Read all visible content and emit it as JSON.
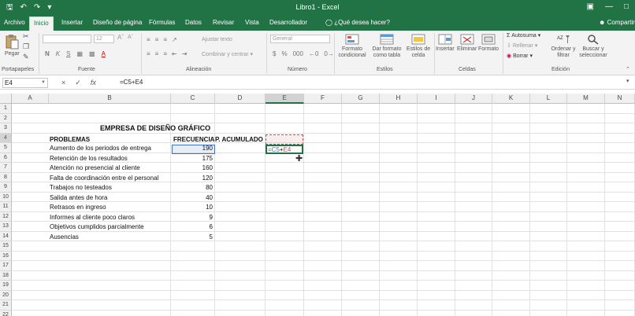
{
  "app": {
    "title": "Libro1  -  Excel",
    "qat": [
      "save",
      "undo",
      "redo",
      "customize"
    ]
  },
  "tabs": [
    "Archivo",
    "Inicio",
    "Insertar",
    "Diseño de página",
    "Fórmulas",
    "Datos",
    "Revisar",
    "Vista",
    "Desarrollador"
  ],
  "tell_me": "¿Qué desea hacer?",
  "share": "Compartir",
  "ribbon": {
    "clipboard": {
      "paste": "Pegar",
      "label": "Portapapeles"
    },
    "font": {
      "name_value": "",
      "size_value": "12",
      "label": "Fuente",
      "styles": [
        "N",
        "K",
        "S"
      ]
    },
    "alignment": {
      "wrap": "Ajustar texto",
      "merge": "Combinar y centrar",
      "label": "Alineación"
    },
    "number": {
      "format_value": "General",
      "label": "Número",
      "symbols": [
        "$",
        "%",
        "000"
      ]
    },
    "styles": {
      "conditional": "Formato condicional",
      "as_table": "Dar formato como tabla",
      "cell_styles": "Estilos de celda",
      "label": "Estilos"
    },
    "cells": {
      "insert": "Insertar",
      "delete": "Eliminar",
      "format": "Formato",
      "label": "Celdas"
    },
    "editing": {
      "autosum": "Autosuma",
      "fill": "Rellenar",
      "clear": "Borrar",
      "sort": "Ordenar y filtrar",
      "find": "Buscar y seleccionar",
      "label": "Edición"
    }
  },
  "formula_bar": {
    "name_box": "E4",
    "formula": "=C5+E4",
    "buttons": [
      "×",
      "✓",
      "fx"
    ]
  },
  "sheet": {
    "columns": [
      "A",
      "B",
      "C",
      "D",
      "E",
      "F",
      "G",
      "H",
      "I",
      "J",
      "K",
      "L",
      "M",
      "N"
    ],
    "rows": [
      "1",
      "2",
      "3",
      "4",
      "5",
      "6",
      "7",
      "8",
      "9",
      "10",
      "11",
      "12",
      "13",
      "14",
      "15",
      "16",
      "17",
      "18",
      "19",
      "20",
      "21",
      "22"
    ],
    "title": "EMPRESA DE DISEÑO GRÁFICO",
    "headers": {
      "problemas": "PROBLEMAS",
      "frecuencia": "FRECUENCIA",
      "acumulado": "P. ACUMULADO"
    },
    "records": [
      {
        "problema": "Aumento de los periodos de entrega",
        "frecuencia": "190"
      },
      {
        "problema": "Retención de los resultados",
        "frecuencia": "175"
      },
      {
        "problema": "Atención no presencial al cliente",
        "frecuencia": "160"
      },
      {
        "problema": "Falta de coordinación entre el personal",
        "frecuencia": "120"
      },
      {
        "problema": "Trabajos no testeados",
        "frecuencia": "80"
      },
      {
        "problema": "Salida antes de hora",
        "frecuencia": "40"
      },
      {
        "problema": "Retrasos en ingreso",
        "frecuencia": "10"
      },
      {
        "problema": "Informes al cliente poco claros",
        "frecuencia": "9"
      },
      {
        "problema": "Objetivos cumplidos parcialmente",
        "frecuencia": "6"
      },
      {
        "problema": "Ausencias",
        "frecuencia": "5"
      }
    ],
    "editing_cell_text": "=C5+E4",
    "colors": {
      "accent": "#217346",
      "ref_blue": "#4472c4",
      "ref_red": "#c0504d"
    }
  }
}
